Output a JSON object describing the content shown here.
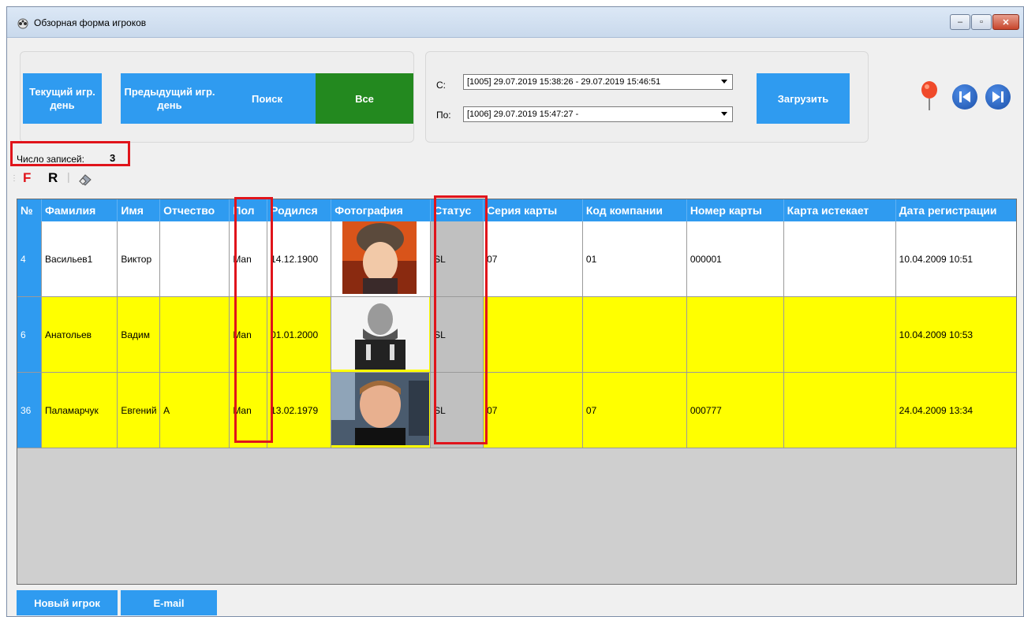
{
  "window": {
    "title": "Обзорная форма игроков",
    "buttons": [
      "–",
      "▫",
      "✕"
    ]
  },
  "toolbar": {
    "btn_current": "Текущий игр. день",
    "btn_previous": "Предыдущий игр. день",
    "btn_search": "Поиск",
    "btn_all": "Все",
    "from_label": "С:",
    "to_label": "По:",
    "from_value": "[1005] 29.07.2019 15:38:26 - 29.07.2019 15:46:51",
    "to_value": "[1006] 29.07.2019 15:47:27 -",
    "btn_load": "Загрузить"
  },
  "records": {
    "label": "Число записей:",
    "count": "3"
  },
  "mini_toolbar": {
    "f": "F",
    "r": "R"
  },
  "table": {
    "columns": [
      "№",
      "Фамилия",
      "Имя",
      "Отчество",
      "Пол",
      "Родился",
      "Фотография",
      "Статус",
      "Серия карты",
      "Код компании",
      "Номер карты",
      "Карта истекает",
      "Дата регистрации"
    ],
    "rows": [
      {
        "num": "4",
        "last": "Васильев1",
        "first": "Виктор",
        "middle": "",
        "sex": "Man",
        "born": "14.12.1900",
        "status": "SL",
        "series": "07",
        "company": "01",
        "card": "000001",
        "expires": "",
        "registered": "10.04.2009 10:51",
        "highlight": false
      },
      {
        "num": "6",
        "last": "Анатольев",
        "first": "Вадим",
        "middle": "",
        "sex": "Man",
        "born": "01.01.2000",
        "status": "SL",
        "series": "",
        "company": "",
        "card": "",
        "expires": "",
        "registered": "10.04.2009 10:53",
        "highlight": true
      },
      {
        "num": "36",
        "last": "Паламарчук",
        "first": "Евгений",
        "middle": "А",
        "sex": "Man",
        "born": "13.02.1979",
        "status": "SL",
        "series": "07",
        "company": "07",
        "card": "000777",
        "expires": "",
        "registered": "24.04.2009 13:34",
        "highlight": true
      }
    ]
  },
  "footer": {
    "btn_new": "Новый игрок",
    "btn_email": "E-mail"
  },
  "colors": {
    "accent": "#2f9bf0",
    "all_button": "#23891f",
    "highlight_row": "#ffff00",
    "marker": "#e0141b"
  }
}
